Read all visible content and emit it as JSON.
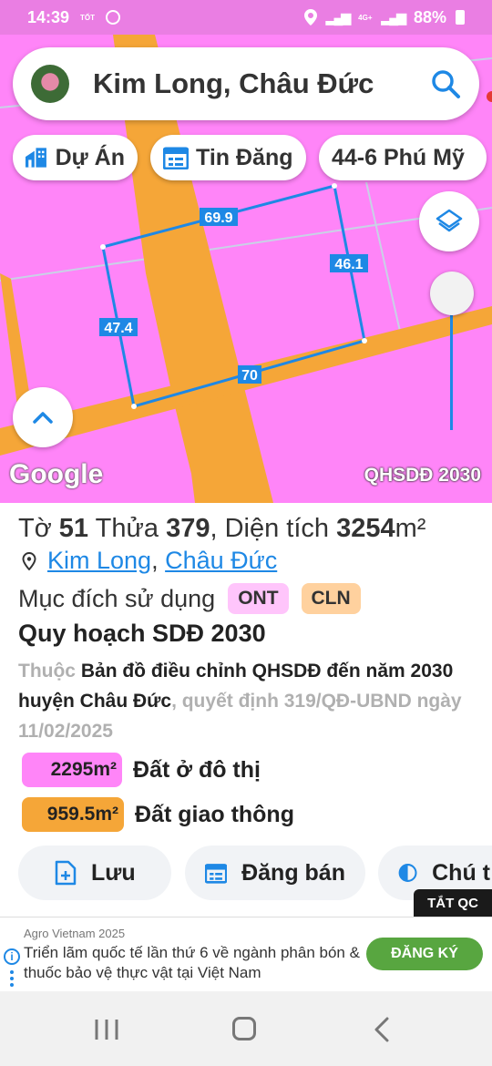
{
  "status_bar": {
    "time": "14:39",
    "carrier_logo": "TỐT",
    "network": "4G+",
    "battery": "88%"
  },
  "search": {
    "query": "Kim Long, Châu Đức"
  },
  "chips": [
    {
      "label": "Dự Án",
      "icon": "building-icon"
    },
    {
      "label": "Tin Đăng",
      "icon": "calendar-icon"
    },
    {
      "label": "44-6 Phú Mỹ",
      "icon": ""
    }
  ],
  "map": {
    "colors": {
      "residential": "#ff85f8",
      "road": "#f5a638",
      "boundary": "#1e88e5"
    },
    "edge_labels": [
      "69.9",
      "46.1",
      "47.4",
      "70"
    ],
    "google_logo": "Google",
    "layer_caption": "QHSDĐ 2030"
  },
  "parcel": {
    "sheet_label": "Tờ",
    "sheet_no": "51",
    "parcel_label": "Thửa",
    "parcel_no": "379",
    "area_label": "Diện tích",
    "area_value": "3254",
    "area_unit": "m²",
    "location_1": "Kim Long",
    "location_sep": ",",
    "location_2": "Châu Đức",
    "purpose_label": "Mục đích sử dụng",
    "purpose_tags": [
      {
        "code": "ONT",
        "color": "#ffc5fb"
      },
      {
        "code": "CLN",
        "color": "#ffd19e"
      }
    ]
  },
  "plan": {
    "heading": "Quy hoạch SDĐ 2030",
    "desc_prefix": "Thuộc",
    "desc_main": "Bản đồ điều chỉnh QHSDĐ đến năm 2030 huyện Châu Đức",
    "desc_suffix": ", quyết định 319/QĐ-UBND ngày 11/02/2025",
    "zones": [
      {
        "area": "2295m²",
        "label": "Đất ở đô thị",
        "color": "#ff85f8"
      },
      {
        "area": "959.5m²",
        "label": "Đất giao thông",
        "color": "#f5a638"
      }
    ]
  },
  "actions": [
    {
      "label": "Lưu",
      "icon": "file-plus-icon"
    },
    {
      "label": "Đăng bán",
      "icon": "calendar-icon"
    },
    {
      "label": "Chú t",
      "icon": "contrast-icon"
    }
  ],
  "ad": {
    "close_label": "TẮT QC",
    "brand": "Agro Vietnam 2025",
    "text": "Triển lãm quốc tế lần thứ 6 về ngành phân bón & thuốc bảo vệ thực vật tại Việt Nam",
    "cta": "ĐĂNG KÝ",
    "info_glyph": "i"
  }
}
